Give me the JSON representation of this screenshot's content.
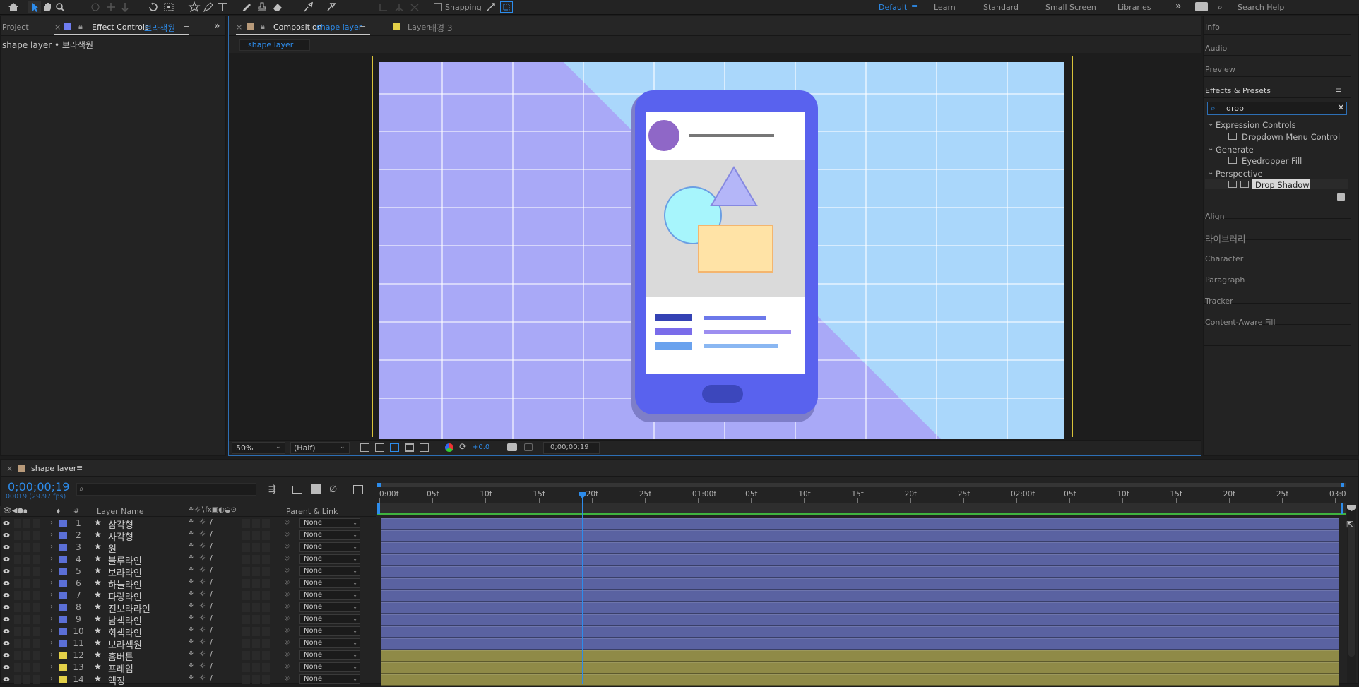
{
  "toolbar": {
    "snapping_label": "Snapping",
    "workspaces": [
      "Default",
      "Learn",
      "Standard",
      "Small Screen",
      "Libraries"
    ],
    "search_placeholder": "Search Help"
  },
  "left_panel": {
    "tab_project": "Project",
    "tab_effect_controls": "Effect Controls",
    "effect_layer": "보라색원",
    "subtitle": "shape layer • 보라색원"
  },
  "comp_panel": {
    "tab_composition": "Composition",
    "comp_name": "shape layer",
    "tab_layer": "Layer",
    "layer_tab_name": "배경 3",
    "breadcrumb": "shape layer",
    "zoom": "50%",
    "resolution": "(Half)",
    "exposure": "+0.0",
    "timecode": "0;00;00;19"
  },
  "right_panel": {
    "items_top": [
      "Info",
      "Audio",
      "Preview"
    ],
    "effects_title": "Effects & Presets",
    "search_value": "drop",
    "tree": [
      {
        "category": "Expression Controls",
        "effect": "Dropdown Menu Control"
      },
      {
        "category": "Generate",
        "effect": "Eyedropper Fill"
      },
      {
        "category": "Perspective",
        "effect": "Drop Shadow"
      }
    ],
    "items_bottom": [
      "Align",
      "라이브러리",
      "Character",
      "Paragraph",
      "Tracker",
      "Content-Aware Fill"
    ]
  },
  "timeline": {
    "tab_name": "shape layer",
    "current_time": "0;00;00;19",
    "frame_info": "00019 (29.97 fps)",
    "col_layer_name": "Layer Name",
    "col_hash": "#",
    "col_parent": "Parent & Link",
    "ruler": [
      "0:00f",
      "05f",
      "10f",
      "15f",
      "20f",
      "25f",
      "01:00f",
      "05f",
      "10f",
      "15f",
      "20f",
      "25f",
      "02:00f",
      "05f",
      "10f",
      "15f",
      "20f",
      "25f",
      "03:0"
    ],
    "parent_none": "None",
    "layers": [
      {
        "num": "1",
        "name": "삼각형",
        "color": "#5b6fd6"
      },
      {
        "num": "2",
        "name": "사각형",
        "color": "#5b6fd6"
      },
      {
        "num": "3",
        "name": "원",
        "color": "#5b6fd6"
      },
      {
        "num": "4",
        "name": "블루라인",
        "color": "#5b6fd6"
      },
      {
        "num": "5",
        "name": "보라라인",
        "color": "#5b6fd6"
      },
      {
        "num": "6",
        "name": "하늘라인",
        "color": "#5b6fd6"
      },
      {
        "num": "7",
        "name": "파랑라인",
        "color": "#5b6fd6"
      },
      {
        "num": "8",
        "name": "진보라라인",
        "color": "#5b6fd6"
      },
      {
        "num": "9",
        "name": "남색라인",
        "color": "#5b6fd6"
      },
      {
        "num": "10",
        "name": "회색라인",
        "color": "#5b6fd6"
      },
      {
        "num": "11",
        "name": "보라색원",
        "color": "#5b6fd6"
      },
      {
        "num": "12",
        "name": "홈버튼",
        "color": "#e3d048"
      },
      {
        "num": "13",
        "name": "프레임",
        "color": "#e3d048"
      },
      {
        "num": "14",
        "name": "액정",
        "color": "#e3d048"
      }
    ]
  },
  "colors": {
    "accent_blue": "#2d8ceb",
    "shape_bar": "#5a62a1",
    "precomp_bar": "#8f8a47",
    "canvas_lavender": "#a9a9f7",
    "canvas_sky": "#aad7fb",
    "phone_blue": "#5962ee"
  }
}
